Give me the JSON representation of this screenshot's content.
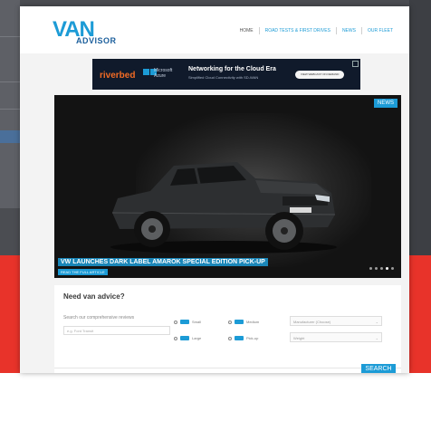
{
  "logo": {
    "top": "VAN",
    "bottom": "ADVISOR"
  },
  "nav": {
    "items": [
      "HOME",
      "ROAD TESTS & FIRST DRIVES",
      "NEWS",
      "OUR FLEET"
    ]
  },
  "ad": {
    "brand": "riverbed",
    "partner": "Microsoft Azure",
    "headline": "Networking for the Cloud Era",
    "subline": "Simplified Cloud Connectivity with SD-WAN",
    "cta": "VIEW WEBCAST ON DEMAND"
  },
  "hero": {
    "badge": "NEWS",
    "headline": "VW LAUNCHES DARK LABEL AMAROK SPECIAL EDITION PICK-UP",
    "readmore": "READ THE FULL ARTICLE",
    "slide_count": 5,
    "active_slide": 4
  },
  "advice": {
    "title": "Need van advice?",
    "description": "Search our comprehensive reviews",
    "input_placeholder": "e.g. Ford Transit",
    "sizes": [
      "Small",
      "Medium",
      "Large",
      "Pick-up"
    ],
    "manufacturer_placeholder": "Manufacturer (Choose)",
    "weight_placeholder": "Weight",
    "search_label": "SEARCH"
  },
  "colors": {
    "accent": "#1c9bd6",
    "red_band": "#e8332a"
  }
}
